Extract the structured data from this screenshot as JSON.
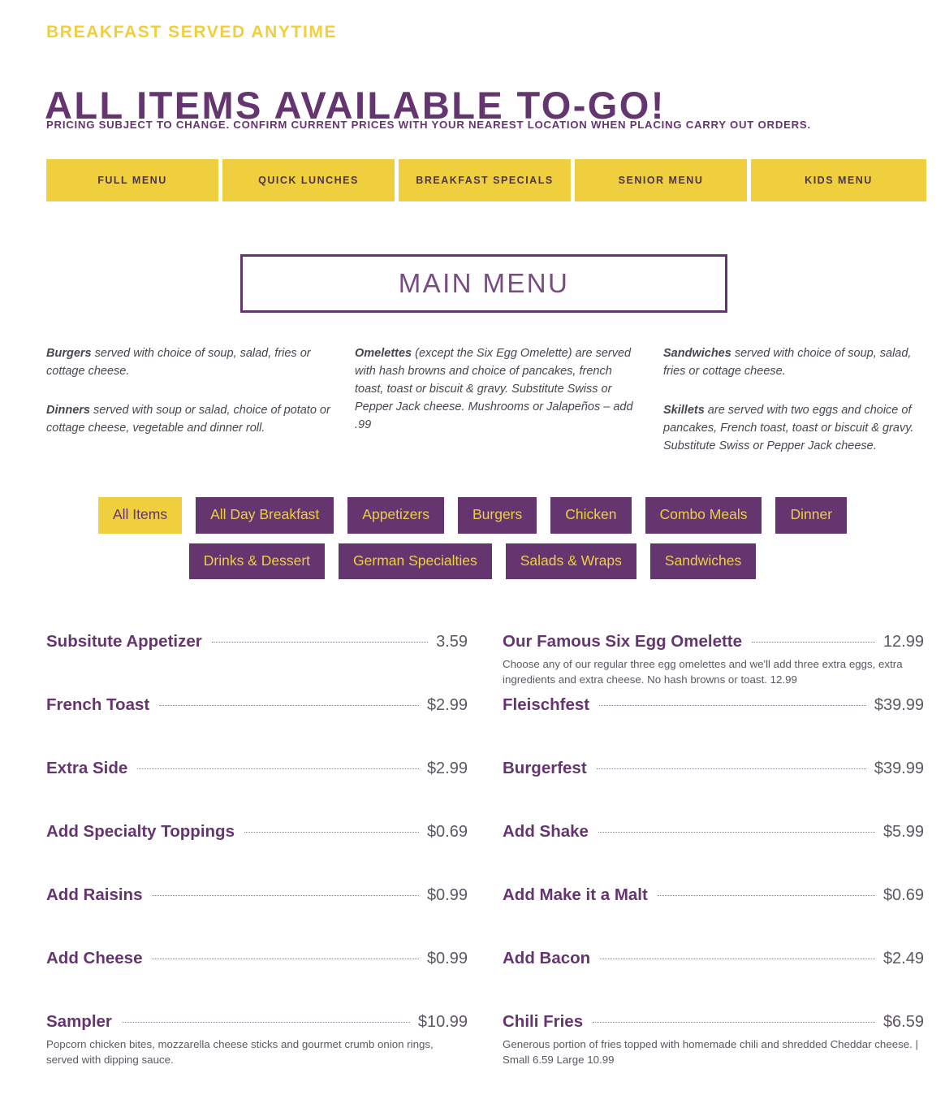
{
  "header": {
    "eyebrow": "BREAKFAST SERVED ANYTIME",
    "headline": "ALL ITEMS AVAILABLE TO-GO!",
    "disclaimer": "PRICING SUBJECT TO CHANGE. CONFIRM CURRENT PRICES WITH YOUR NEAREST LOCATION WHEN PLACING CARRY OUT ORDERS."
  },
  "colors": {
    "purple": "#653570",
    "yellow": "#EFCF3E",
    "body_text": "#5d5663"
  },
  "tabs": [
    {
      "label": "FULL MENU"
    },
    {
      "label": "QUICK LUNCHES"
    },
    {
      "label": "BREAKFAST SPECIALS"
    },
    {
      "label": "SENIOR MENU"
    },
    {
      "label": "KIDS MENU"
    }
  ],
  "section": {
    "title": "MAIN MENU"
  },
  "intro": {
    "col1": [
      {
        "lead": "Burgers",
        "text": " served with choice of soup, salad, fries or cottage cheese."
      },
      {
        "lead": "Dinners",
        "text": " served with soup or salad, choice of potato or cottage cheese, vegetable and dinner roll."
      }
    ],
    "col2": [
      {
        "lead": "Omelettes",
        "text": " (except the Six Egg Omelette) are served with hash browns and choice of pancakes, french toast, toast or biscuit & gravy. Substitute Swiss or Pepper Jack cheese. Mushrooms or Jalapeños – add .99"
      }
    ],
    "col3": [
      {
        "lead": "Sandwiches",
        "text": " served with choice of soup, salad, fries or cottage cheese."
      },
      {
        "lead": "Skillets",
        "text": " are served with two eggs and choice of pancakes, French toast, toast or biscuit & gravy. Substitute Swiss or Pepper Jack cheese."
      }
    ]
  },
  "filters": {
    "row1": [
      {
        "label": "All Items",
        "active": true
      },
      {
        "label": "All Day Breakfast",
        "active": false
      },
      {
        "label": "Appetizers",
        "active": false
      },
      {
        "label": "Burgers",
        "active": false
      },
      {
        "label": "Chicken",
        "active": false
      },
      {
        "label": "Combo Meals",
        "active": false
      },
      {
        "label": "Dinner",
        "active": false
      }
    ],
    "row2": [
      {
        "label": "Drinks & Dessert",
        "active": false
      },
      {
        "label": "German Specialties",
        "active": false
      },
      {
        "label": "Salads & Wraps",
        "active": false
      },
      {
        "label": "Sandwiches",
        "active": false
      }
    ]
  },
  "menu_items": [
    {
      "name": "Subsitute Appetizer",
      "price": "3.59",
      "description": ""
    },
    {
      "name": "Our Famous Six Egg Omelette",
      "price": "12.99",
      "description": "Choose any of our regular three egg omelettes and we'll add three extra eggs, extra ingredients and extra cheese. No hash browns or toast. 12.99"
    },
    {
      "name": "French Toast",
      "price": "$2.99",
      "description": ""
    },
    {
      "name": "Fleischfest",
      "price": "$39.99",
      "description": ""
    },
    {
      "name": "Extra Side",
      "price": "$2.99",
      "description": ""
    },
    {
      "name": "Burgerfest",
      "price": "$39.99",
      "description": ""
    },
    {
      "name": "Add Specialty Toppings",
      "price": "$0.69",
      "description": ""
    },
    {
      "name": "Add Shake",
      "price": "$5.99",
      "description": ""
    },
    {
      "name": "Add Raisins",
      "price": "$0.99",
      "description": ""
    },
    {
      "name": "Add Make it a Malt",
      "price": "$0.69",
      "description": ""
    },
    {
      "name": "Add Cheese",
      "price": "$0.99",
      "description": ""
    },
    {
      "name": "Add Bacon",
      "price": "$2.49",
      "description": ""
    },
    {
      "name": "Sampler",
      "price": "$10.99",
      "description": "Popcorn chicken bites, mozzarella cheese sticks and gourmet crumb onion rings, served with dipping sauce."
    },
    {
      "name": "Chili Fries",
      "price": "$6.59",
      "description": "Generous portion of fries topped with homemade chili and shredded Cheddar cheese. | Small 6.59 Large 10.99"
    }
  ]
}
